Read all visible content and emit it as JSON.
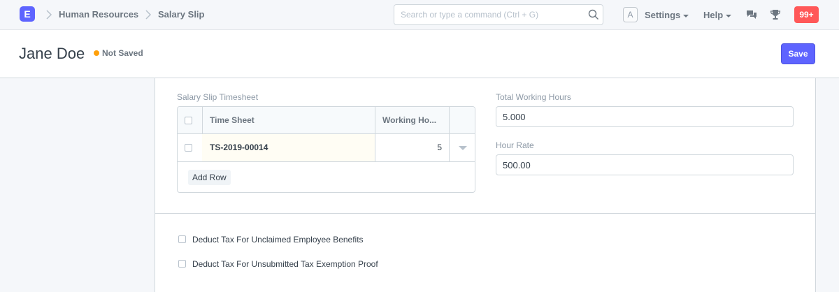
{
  "navbar": {
    "logo_letter": "E",
    "breadcrumbs": [
      "Human Resources",
      "Salary Slip"
    ],
    "search_placeholder": "Search or type a command (Ctrl + G)",
    "avatar_letter": "A",
    "settings_label": "Settings",
    "help_label": "Help",
    "notification_count": "99+"
  },
  "page": {
    "title": "Jane Doe",
    "status": "Not Saved",
    "save_label": "Save"
  },
  "timesheet_section": {
    "grid_label": "Salary Slip Timesheet",
    "columns": [
      "Time Sheet",
      "Working Ho..."
    ],
    "rows": [
      {
        "time_sheet": "TS-2019-00014",
        "working_hours": "5"
      }
    ],
    "add_row_label": "Add Row",
    "total_working_hours_label": "Total Working Hours",
    "total_working_hours_value": "5.000",
    "hour_rate_label": "Hour Rate",
    "hour_rate_value": "500.00"
  },
  "tax_section": {
    "options": [
      "Deduct Tax For Unclaimed Employee Benefits",
      "Deduct Tax For Unsubmitted Tax Exemption Proof"
    ]
  },
  "colors": {
    "primary": "#5e64ff",
    "status_dot": "#ffa00a",
    "badge": "#ff5858"
  }
}
